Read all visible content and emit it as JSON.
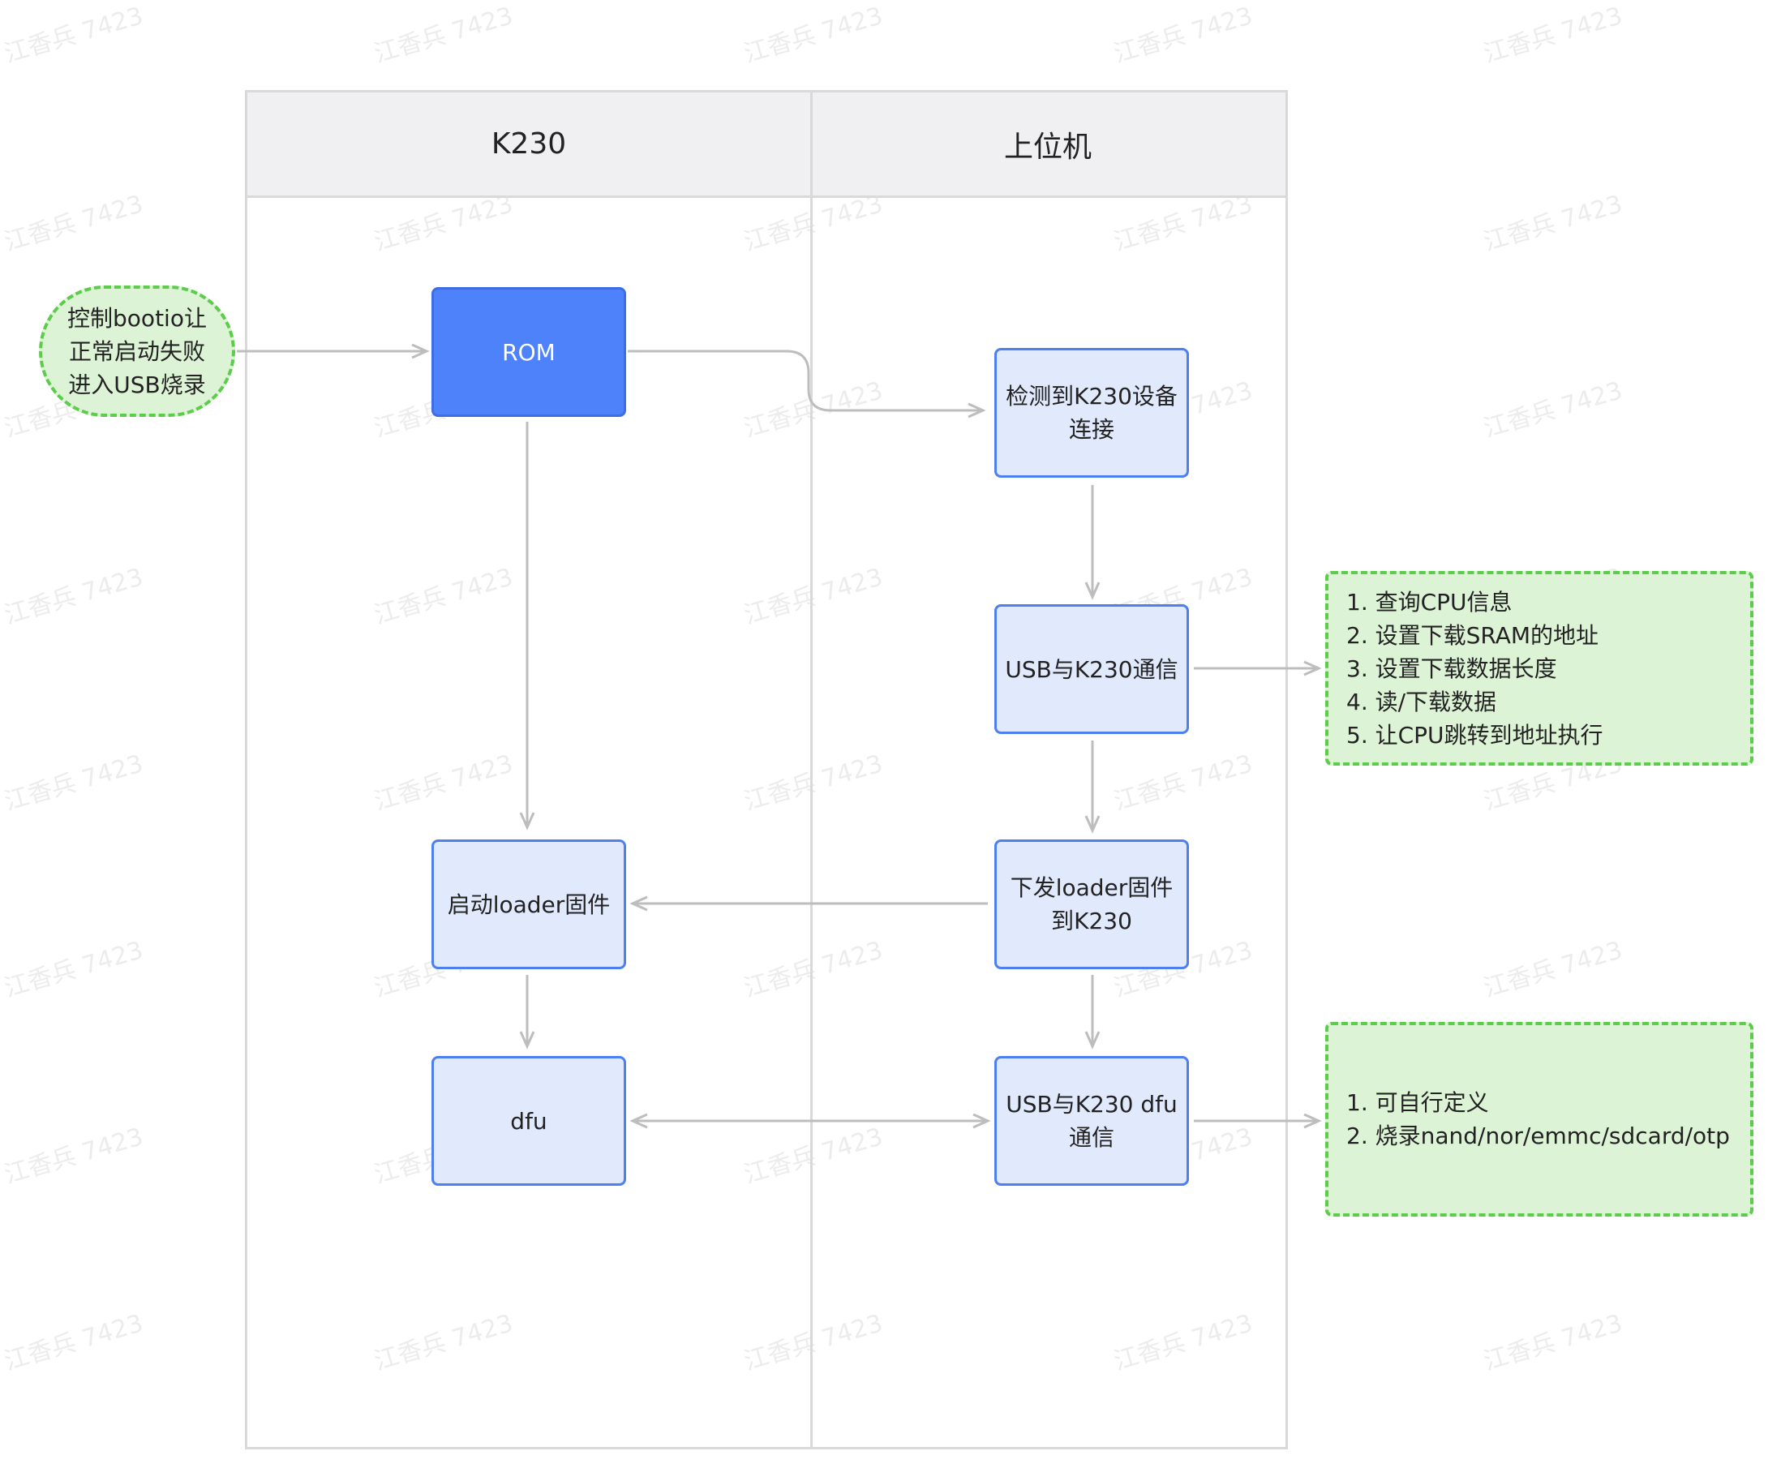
{
  "watermark": "江香兵 7423",
  "lanes": {
    "left_title": "K230",
    "right_title": "上位机"
  },
  "start": {
    "lines": [
      "控制bootio让",
      "正常启动失败",
      "进入USB烧录"
    ]
  },
  "nodes": {
    "rom": "ROM",
    "detect": [
      "检测到K230设备",
      "连接"
    ],
    "usb_comm": "USB与K230通信",
    "send_loader": [
      "下发loader固件",
      "到K230"
    ],
    "start_loader": "启动loader固件",
    "dfu": "dfu",
    "usb_dfu": [
      "USB与K230 dfu",
      "通信"
    ]
  },
  "notes": {
    "usb_comm_steps": [
      "1. 查询CPU信息",
      "2. 设置下载SRAM的地址",
      "3. 设置下载数据长度",
      "4. 读/下载数据",
      "5. 让CPU跳转到地址执行"
    ],
    "dfu_steps": [
      "1. 可自行定义",
      "2. 烧录nand/nor/emmc/sdcard/otp"
    ]
  },
  "colors": {
    "node_fill": "#e1e9fd",
    "node_border": "#4e7ff0",
    "primary_fill": "#4e82fb",
    "note_fill": "#ddf3d5",
    "note_border": "#5ccc4b",
    "edge": "#bdbdbd"
  }
}
